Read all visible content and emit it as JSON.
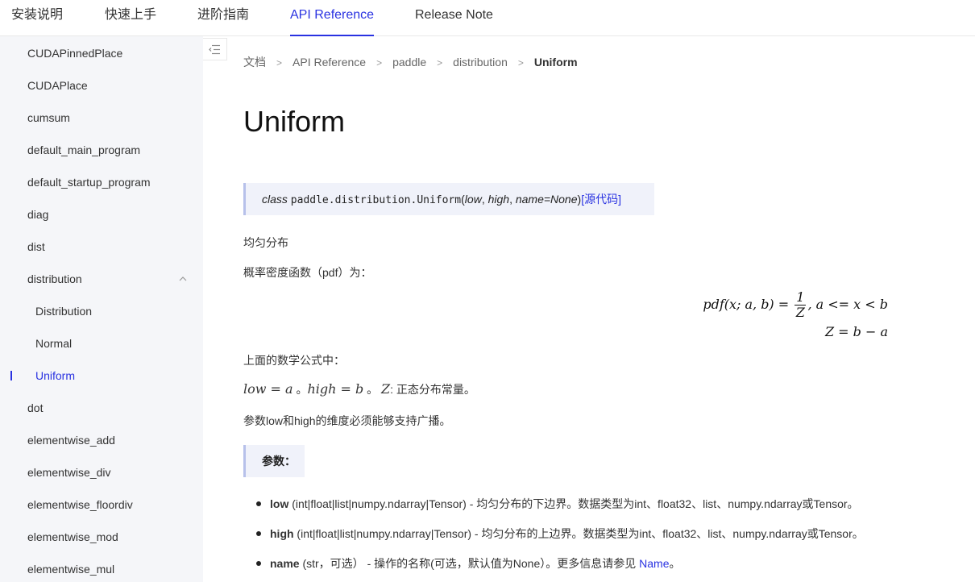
{
  "topnav": {
    "tabs": [
      {
        "label": "安装说明"
      },
      {
        "label": "快速上手"
      },
      {
        "label": "进阶指南"
      },
      {
        "label": "API Reference"
      },
      {
        "label": "Release Note"
      }
    ]
  },
  "sidebar": {
    "items": [
      {
        "label": "CUDAPinnedPlace"
      },
      {
        "label": "CUDAPlace"
      },
      {
        "label": "cumsum"
      },
      {
        "label": "default_main_program"
      },
      {
        "label": "default_startup_program"
      },
      {
        "label": "diag"
      },
      {
        "label": "dist"
      },
      {
        "label": "distribution"
      },
      {
        "label": "Distribution"
      },
      {
        "label": "Normal"
      },
      {
        "label": "Uniform"
      },
      {
        "label": "dot"
      },
      {
        "label": "elementwise_add"
      },
      {
        "label": "elementwise_div"
      },
      {
        "label": "elementwise_floordiv"
      },
      {
        "label": "elementwise_mod"
      },
      {
        "label": "elementwise_mul"
      }
    ]
  },
  "breadcrumb": {
    "items": [
      "文档",
      "API Reference",
      "paddle",
      "distribution",
      "Uniform"
    ],
    "separator": ">"
  },
  "page": {
    "title": "Uniform",
    "signature": {
      "keyword": "class",
      "path": "paddle.distribution.Uniform",
      "open": "(",
      "arg1": "low",
      "comma1": ", ",
      "arg2": "high",
      "comma2": ", ",
      "arg3": "name=None",
      "close": ")",
      "source_link": "[源代码]"
    },
    "desc1": "均匀分布",
    "desc2": "概率密度函数（pdf）为：",
    "formula1_left": "pdf(x; a, b) =",
    "formula1_num": "1",
    "formula1_den": "Z",
    "formula1_right": ", a <= x < b",
    "formula2": "Z = b − a",
    "desc3": "上面的数学公式中：",
    "desc4_low": "low = a",
    "desc4_sep1": " 。",
    "desc4_high": "high = b",
    "desc4_sep2": " 。 ",
    "desc4_z": "Z",
    "desc4_rest": ": 正态分布常量。",
    "desc5": "参数low和high的维度必须能够支持广播。",
    "params_heading": "参数：",
    "params": [
      {
        "name": "low",
        "desc": " (int|float|list|numpy.ndarray|Tensor) - 均匀分布的下边界。数据类型为int、float32、list、numpy.ndarray或Tensor。"
      },
      {
        "name": "high",
        "desc": " (int|float|list|numpy.ndarray|Tensor) - 均匀分布的上边界。数据类型为int、float32、list、numpy.ndarray或Tensor。"
      },
      {
        "name": "name",
        "desc": " (str，可选） - 操作的名称(可选，默认值为None）。更多信息请参见 ",
        "link": "Name",
        "tail": "。"
      }
    ]
  },
  "colors": {
    "accent": "#2932e1",
    "sidebar_bg": "#f5f6f9",
    "signature_bg": "#f0f2fa"
  },
  "icons": {
    "collapse": "list-collapse-icon",
    "expand": "chevron-up-icon"
  }
}
